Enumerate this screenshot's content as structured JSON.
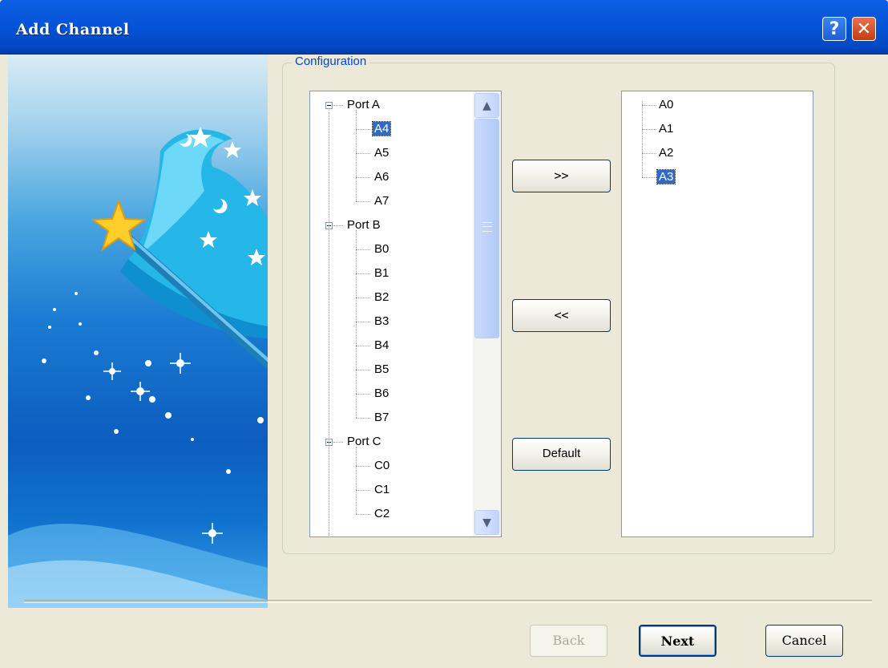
{
  "window": {
    "title": "Add Channel"
  },
  "titlebar": {
    "help_glyph": "?",
    "close_glyph": "✕"
  },
  "config": {
    "group_label": "Configuration"
  },
  "available": {
    "nodes": [
      {
        "label": "Port A",
        "type": "group"
      },
      {
        "label": "A4",
        "type": "item",
        "selected": true
      },
      {
        "label": "A5",
        "type": "item"
      },
      {
        "label": "A6",
        "type": "item"
      },
      {
        "label": "A7",
        "type": "item"
      },
      {
        "label": "Port B",
        "type": "group"
      },
      {
        "label": "B0",
        "type": "item"
      },
      {
        "label": "B1",
        "type": "item"
      },
      {
        "label": "B2",
        "type": "item"
      },
      {
        "label": "B3",
        "type": "item"
      },
      {
        "label": "B4",
        "type": "item"
      },
      {
        "label": "B5",
        "type": "item"
      },
      {
        "label": "B6",
        "type": "item"
      },
      {
        "label": "B7",
        "type": "item"
      },
      {
        "label": "Port C",
        "type": "group"
      },
      {
        "label": "C0",
        "type": "item"
      },
      {
        "label": "C1",
        "type": "item"
      },
      {
        "label": "C2",
        "type": "item"
      }
    ]
  },
  "selected_channels": {
    "nodes": [
      {
        "label": "A0"
      },
      {
        "label": "A1"
      },
      {
        "label": "A2"
      },
      {
        "label": "A3",
        "selected": true
      }
    ]
  },
  "buttons": {
    "add": ">>",
    "remove": "<<",
    "default": "Default"
  },
  "scrollbar": {
    "up_glyph": "▲",
    "down_glyph": "▼"
  },
  "footer": {
    "back": "Back",
    "next": "Next",
    "cancel": "Cancel"
  },
  "colors": {
    "titlebar": "#0553d6",
    "selection": "#316ac5",
    "accent": "#0046d5"
  }
}
